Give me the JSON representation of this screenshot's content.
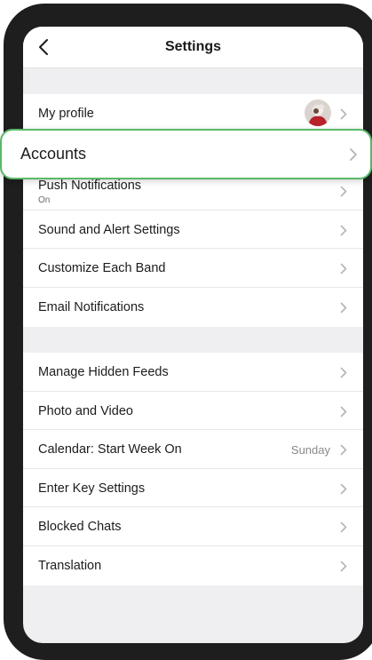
{
  "nav": {
    "title": "Settings",
    "back_icon": "chevron-left-icon"
  },
  "highlight": {
    "label": "Accounts",
    "border_color": "#58b868"
  },
  "section1": [
    {
      "label": "My profile",
      "has_avatar": true
    },
    {
      "label": "Push Notifications",
      "sub": "On"
    },
    {
      "label": "Sound and Alert Settings"
    },
    {
      "label": "Customize Each Band"
    },
    {
      "label": "Email Notifications"
    }
  ],
  "section2": [
    {
      "label": "Manage Hidden Feeds"
    },
    {
      "label": "Photo and Video"
    },
    {
      "label": "Calendar: Start Week On",
      "value": "Sunday"
    },
    {
      "label": "Enter Key Settings"
    },
    {
      "label": "Blocked Chats"
    },
    {
      "label": "Translation"
    }
  ],
  "icons": {
    "row_chevron": "chevron-right-icon",
    "profile": "avatar"
  }
}
